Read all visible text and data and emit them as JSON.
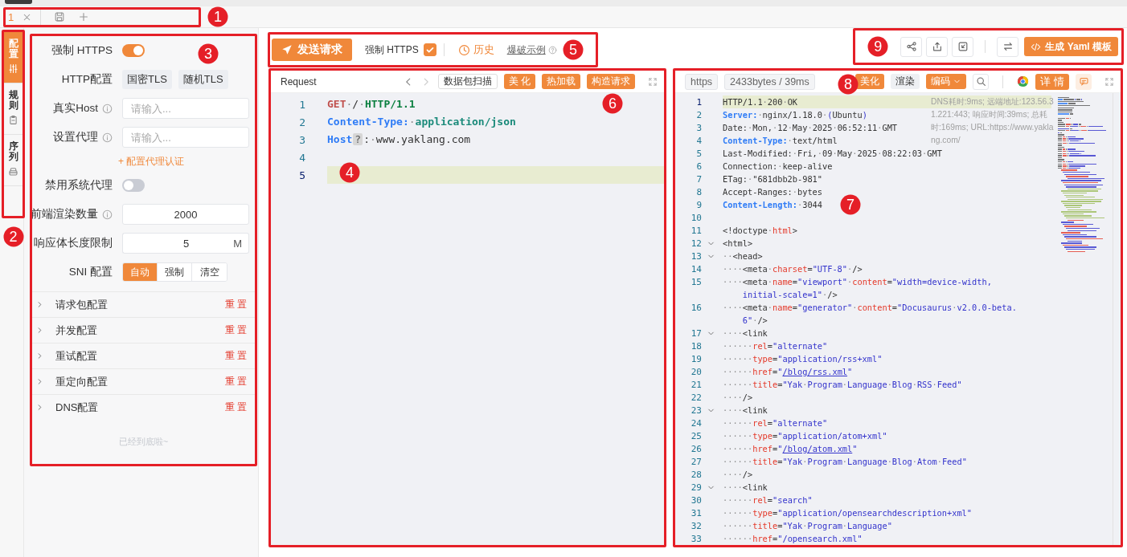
{
  "tab_bar": {
    "callouts": [
      "1"
    ],
    "tabs": [
      {
        "label": "1",
        "selected": true
      }
    ]
  },
  "side_tabs": {
    "callouts": [
      "2"
    ],
    "items": [
      {
        "label": "配置",
        "selected": true
      },
      {
        "label": "规则",
        "selected": false
      },
      {
        "label": "序列",
        "selected": false
      }
    ]
  },
  "config": {
    "callouts": [
      "3"
    ],
    "rows": [
      {
        "kind": "switch",
        "label": "强制 HTTPS",
        "on": true
      },
      {
        "kind": "buttons",
        "label": "HTTP配置",
        "buttons": [
          "国密TLS",
          "随机TLS"
        ]
      },
      {
        "kind": "input",
        "label": "真实Host",
        "info": true,
        "placeholder": "请输入..."
      },
      {
        "kind": "input",
        "label": "设置代理",
        "info": true,
        "placeholder": "请输入..."
      },
      {
        "kind": "link",
        "text": "+ 配置代理认证"
      },
      {
        "kind": "switch",
        "label": "禁用系统代理",
        "on": false
      },
      {
        "kind": "input",
        "label": "前端渲染数量",
        "info": true,
        "value": "2000"
      },
      {
        "kind": "input",
        "label": "响应体长度限制",
        "info": false,
        "value": "5",
        "suffix": "M"
      },
      {
        "kind": "segmented",
        "label": "SNI 配置",
        "options": [
          {
            "label": "自动",
            "selected": true
          },
          {
            "label": "强制",
            "selected": false
          },
          {
            "label": "清空",
            "selected": false
          }
        ]
      }
    ],
    "sections": [
      {
        "title": "请求包配置",
        "action": "重 置",
        "expanded": false
      },
      {
        "title": "并发配置",
        "action": "重 置",
        "expanded": false
      },
      {
        "title": "重试配置",
        "action": "重 置",
        "expanded": false
      },
      {
        "title": "重定向配置",
        "action": "重 置",
        "expanded": false
      },
      {
        "title": "DNS配置",
        "action": "重 置",
        "expanded": false
      }
    ],
    "end_note": "已经到底啦~"
  },
  "toolbar": {
    "callouts": [
      "5"
    ],
    "send": "发送请求",
    "force_https": {
      "label": "强制 HTTPS",
      "checked": true
    },
    "history": "历史",
    "example_link": "爆破示例"
  },
  "actions": {
    "callouts": [
      "9"
    ],
    "generate": "生成 Yaml 模板"
  },
  "request": {
    "callouts": [
      "4",
      "6"
    ],
    "title": "Request",
    "buttons": [
      {
        "label": "数据包扫描",
        "kind": "outline"
      },
      {
        "label": "美 化",
        "kind": "primary"
      },
      {
        "label": "热加载",
        "kind": "primary"
      },
      {
        "label": "构造请求",
        "kind": "primary"
      }
    ],
    "lines": [
      {
        "n": "1",
        "current": false,
        "tokens": [
          {
            "text": "GET",
            "kind": "method"
          },
          {
            "text": "·/·",
            "kind": "plain"
          },
          {
            "text": "HTTP/1.1",
            "kind": "proto"
          }
        ]
      },
      {
        "n": "2",
        "current": false,
        "tokens": [
          {
            "text": "Content-Type:",
            "kind": "key"
          },
          {
            "text": "·",
            "kind": "plain"
          },
          {
            "text": "application/json",
            "kind": "value"
          }
        ]
      },
      {
        "n": "3",
        "current": false,
        "tokens": [
          {
            "text": "Host",
            "kind": "key"
          },
          {
            "text": "?",
            "kind": "hint"
          },
          {
            "text": ":·www.yaklang.com",
            "kind": "plain"
          }
        ]
      },
      {
        "n": "4",
        "current": false
      },
      {
        "n": "5",
        "current": true
      }
    ]
  },
  "response": {
    "callouts": [
      "8",
      "7"
    ],
    "scheme": "https",
    "size": "2433bytes / 39ms",
    "detail": "详 情",
    "buttons": [
      {
        "label": "美化",
        "kind": "primary"
      },
      {
        "label": "渲染",
        "kind": "plain"
      },
      {
        "label": "编码",
        "kind": "dropdown"
      }
    ],
    "hint": [
      "DNS耗时:9ms; 远端地址:123.56.3",
      "1.221:443; 响应时间:39ms; 总耗",
      "时:169ms; URL:https://www.yakla",
      "ng.com/"
    ],
    "lines": [
      {
        "n": "1",
        "current": true,
        "tokens": [
          {
            "text": "HTTP/1.1·200·OK",
            "kind": "plain"
          }
        ]
      },
      {
        "n": "2",
        "current": false,
        "tokens": [
          {
            "text": "Server:",
            "kind": "key"
          },
          {
            "text": "·nginx/1.18.0·",
            "kind": "plain"
          },
          {
            "text": "(",
            "kind": "string"
          },
          {
            "text": "Ubuntu",
            "kind": "plain"
          },
          {
            "text": ")",
            "kind": "string"
          }
        ]
      },
      {
        "n": "3",
        "current": false,
        "tokens": [
          {
            "text": "Date:·Mon,·12·May·2025·06:52:11·GMT",
            "kind": "plain"
          }
        ]
      },
      {
        "n": "4",
        "current": false,
        "tokens": [
          {
            "text": "Content-Type:",
            "kind": "key"
          },
          {
            "text": "·text/html",
            "kind": "plain"
          }
        ]
      },
      {
        "n": "5",
        "current": false,
        "tokens": [
          {
            "text": "Last-Modified:·Fri,·09·May·2025·08:22:03·GMT",
            "kind": "plain"
          }
        ]
      },
      {
        "n": "6",
        "current": false,
        "tokens": [
          {
            "text": "Connection:·keep-alive",
            "kind": "plain"
          }
        ]
      },
      {
        "n": "7",
        "current": false,
        "tokens": [
          {
            "text": "ETag:·\"681dbb2b-981\"",
            "kind": "plain"
          }
        ]
      },
      {
        "n": "8",
        "current": false,
        "tokens": [
          {
            "text": "Accept-Ranges:·bytes",
            "kind": "plain"
          }
        ]
      },
      {
        "n": "9",
        "current": false,
        "tokens": [
          {
            "text": "Content-Length:",
            "kind": "key"
          },
          {
            "text": "·3044",
            "kind": "plain"
          }
        ]
      },
      {
        "n": "10",
        "current": false
      },
      {
        "n": "11",
        "current": false,
        "tokens": [
          {
            "text": "<!doctype·",
            "kind": "plain"
          },
          {
            "text": "html",
            "kind": "attr"
          },
          {
            "text": ">",
            "kind": "plain"
          }
        ]
      },
      {
        "n": "12",
        "current": false,
        "expanded": true,
        "tokens": [
          {
            "text": "<html>",
            "kind": "plain"
          }
        ]
      },
      {
        "n": "13",
        "current": false,
        "expanded": true,
        "tokens": [
          {
            "text": "··<head>",
            "kind": "plain"
          }
        ]
      },
      {
        "n": "14",
        "current": false,
        "tokens": [
          {
            "text": "····<meta·",
            "kind": "plain"
          },
          {
            "text": "charset",
            "kind": "attr"
          },
          {
            "text": "=",
            "kind": "plain"
          },
          {
            "text": "\"UTF-8\"",
            "kind": "string"
          },
          {
            "text": "·/>",
            "kind": "plain"
          }
        ]
      },
      {
        "n": "15",
        "current": false,
        "tokens": [
          {
            "text": "····<meta·",
            "kind": "plain"
          },
          {
            "text": "name",
            "kind": "attr"
          },
          {
            "text": "=",
            "kind": "plain"
          },
          {
            "text": "\"viewport\"",
            "kind": "string"
          },
          {
            "text": "·",
            "kind": "plain"
          },
          {
            "text": "content",
            "kind": "attr"
          },
          {
            "text": "=",
            "kind": "plain"
          },
          {
            "text": "\"width=device-width,",
            "kind": "string"
          }
        ],
        "continuation": {
          "tokens": [
            {
              "text": "initial-scale=1\"",
              "kind": "string"
            },
            {
              "text": "·/>",
              "kind": "plain"
            }
          ]
        }
      },
      {
        "n": "16",
        "current": false,
        "tokens": [
          {
            "text": "····<meta·",
            "kind": "plain"
          },
          {
            "text": "name",
            "kind": "attr"
          },
          {
            "text": "=",
            "kind": "plain"
          },
          {
            "text": "\"generator\"",
            "kind": "string"
          },
          {
            "text": "·",
            "kind": "plain"
          },
          {
            "text": "content",
            "kind": "attr"
          },
          {
            "text": "=",
            "kind": "plain"
          },
          {
            "text": "\"Docusaurus·v2.0.0-beta.",
            "kind": "string"
          }
        ],
        "continuation": {
          "tokens": [
            {
              "text": "6\"",
              "kind": "string"
            },
            {
              "text": "·/>",
              "kind": "plain"
            }
          ]
        }
      },
      {
        "n": "17",
        "current": false,
        "expanded": true,
        "tokens": [
          {
            "text": "····<link",
            "kind": "plain"
          }
        ]
      },
      {
        "n": "18",
        "current": false,
        "tokens": [
          {
            "text": "······",
            "kind": "plain"
          },
          {
            "text": "rel",
            "kind": "attr"
          },
          {
            "text": "=",
            "kind": "plain"
          },
          {
            "text": "\"alternate\"",
            "kind": "string"
          }
        ]
      },
      {
        "n": "19",
        "current": false,
        "tokens": [
          {
            "text": "······",
            "kind": "plain"
          },
          {
            "text": "type",
            "kind": "attr"
          },
          {
            "text": "=",
            "kind": "plain"
          },
          {
            "text": "\"application/rss+xml\"",
            "kind": "string"
          }
        ]
      },
      {
        "n": "20",
        "current": false,
        "tokens": [
          {
            "text": "······",
            "kind": "plain"
          },
          {
            "text": "href",
            "kind": "attr"
          },
          {
            "text": "=",
            "kind": "plain"
          },
          {
            "text": "\"",
            "kind": "string"
          },
          {
            "text": "/blog/rss.xml",
            "kind": "link"
          },
          {
            "text": "\"",
            "kind": "string"
          }
        ]
      },
      {
        "n": "21",
        "current": false,
        "tokens": [
          {
            "text": "······",
            "kind": "plain"
          },
          {
            "text": "title",
            "kind": "attr"
          },
          {
            "text": "=",
            "kind": "plain"
          },
          {
            "text": "\"Yak·Program·Language·Blog·RSS·Feed\"",
            "kind": "string"
          }
        ]
      },
      {
        "n": "22",
        "current": false,
        "tokens": [
          {
            "text": "····/>",
            "kind": "plain"
          }
        ]
      },
      {
        "n": "23",
        "current": false,
        "expanded": true,
        "tokens": [
          {
            "text": "····<link",
            "kind": "plain"
          }
        ]
      },
      {
        "n": "24",
        "current": false,
        "tokens": [
          {
            "text": "······",
            "kind": "plain"
          },
          {
            "text": "rel",
            "kind": "attr"
          },
          {
            "text": "=",
            "kind": "plain"
          },
          {
            "text": "\"alternate\"",
            "kind": "string"
          }
        ]
      },
      {
        "n": "25",
        "current": false,
        "tokens": [
          {
            "text": "······",
            "kind": "plain"
          },
          {
            "text": "type",
            "kind": "attr"
          },
          {
            "text": "=",
            "kind": "plain"
          },
          {
            "text": "\"application/atom+xml\"",
            "kind": "string"
          }
        ]
      },
      {
        "n": "26",
        "current": false,
        "tokens": [
          {
            "text": "······",
            "kind": "plain"
          },
          {
            "text": "href",
            "kind": "attr"
          },
          {
            "text": "=",
            "kind": "plain"
          },
          {
            "text": "\"",
            "kind": "string"
          },
          {
            "text": "/blog/atom.xml",
            "kind": "link"
          },
          {
            "text": "\"",
            "kind": "string"
          }
        ]
      },
      {
        "n": "27",
        "current": false,
        "tokens": [
          {
            "text": "······",
            "kind": "plain"
          },
          {
            "text": "title",
            "kind": "attr"
          },
          {
            "text": "=",
            "kind": "plain"
          },
          {
            "text": "\"Yak·Program·Language·Blog·Atom·Feed\"",
            "kind": "string"
          }
        ]
      },
      {
        "n": "28",
        "current": false,
        "tokens": [
          {
            "text": "····/>",
            "kind": "plain"
          }
        ]
      },
      {
        "n": "29",
        "current": false,
        "expanded": true,
        "tokens": [
          {
            "text": "····<link",
            "kind": "plain"
          }
        ]
      },
      {
        "n": "30",
        "current": false,
        "tokens": [
          {
            "text": "······",
            "kind": "plain"
          },
          {
            "text": "rel",
            "kind": "attr"
          },
          {
            "text": "=",
            "kind": "plain"
          },
          {
            "text": "\"search\"",
            "kind": "string"
          }
        ]
      },
      {
        "n": "31",
        "current": false,
        "tokens": [
          {
            "text": "······",
            "kind": "plain"
          },
          {
            "text": "type",
            "kind": "attr"
          },
          {
            "text": "=",
            "kind": "plain"
          },
          {
            "text": "\"application/opensearchdescription+xml\"",
            "kind": "string"
          }
        ]
      },
      {
        "n": "32",
        "current": false,
        "tokens": [
          {
            "text": "······",
            "kind": "plain"
          },
          {
            "text": "title",
            "kind": "attr"
          },
          {
            "text": "=",
            "kind": "plain"
          },
          {
            "text": "\"Yak·Program·Language\"",
            "kind": "string"
          }
        ]
      },
      {
        "n": "33",
        "current": false,
        "tokens": [
          {
            "text": "······",
            "kind": "plain"
          },
          {
            "text": "href",
            "kind": "attr"
          },
          {
            "text": "=",
            "kind": "plain"
          },
          {
            "text": "\"/opensearch.xml\"",
            "kind": "string"
          }
        ]
      }
    ]
  }
}
